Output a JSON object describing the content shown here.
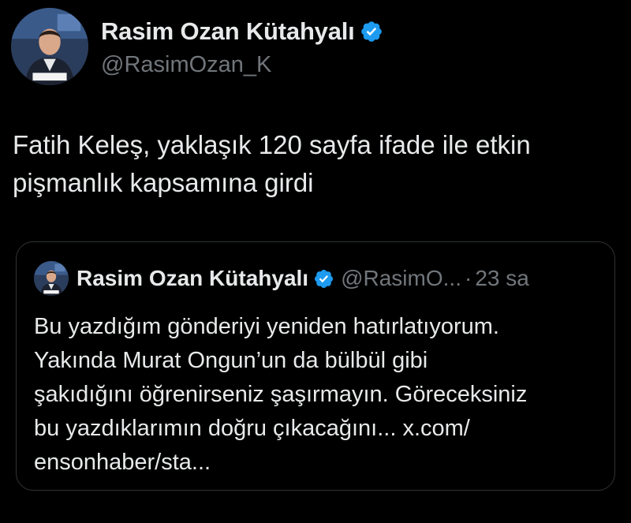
{
  "tweet": {
    "author": {
      "display_name": "Rasim Ozan Kütahyalı",
      "handle": "@RasimOzan_K",
      "verified": true,
      "avatar": "profile-photo"
    },
    "text_line1": "Fatih Keleş, yaklaşık 120 sayfa ifade ile etkin",
    "text_line2": "pişmanlık kapsamına girdi"
  },
  "quote": {
    "author": {
      "display_name": "Rasim Ozan Kütahyalı",
      "handle": "@RasimO...",
      "verified": true,
      "avatar": "profile-photo"
    },
    "separator": "·",
    "time": "23 sa",
    "text_lines": [
      "Bu yazdığım gönderiyi yeniden hatırlatıyorum.",
      "Yakında Murat Ongun’un da bülbül gibi",
      "şakıdığını öğrenirseniz şaşırmayın. Göreceksiniz",
      "bu yazdıklarımın doğru çıkacağını... x.com/",
      "ensonhaber/sta..."
    ]
  },
  "colors": {
    "background": "#000000",
    "text": "#e7e9ea",
    "secondary_text": "#71767b",
    "verified_badge": "#1d9bf0",
    "card_border": "#2f3336"
  },
  "icons": {
    "verified": "verified-badge-icon"
  }
}
